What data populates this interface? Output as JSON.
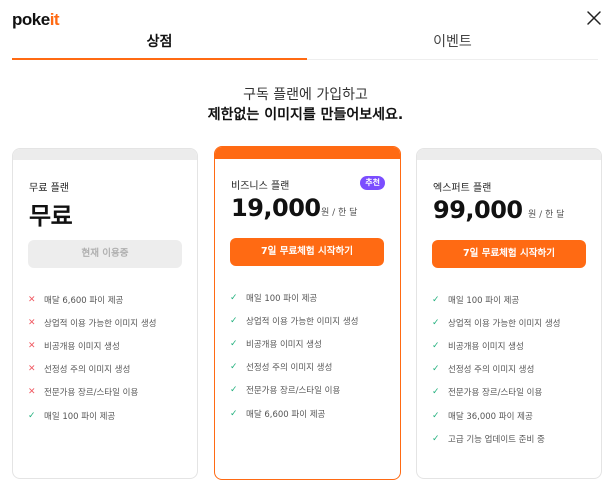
{
  "brand": {
    "name_main": "poke",
    "name_accent": "it",
    "accent_color": "#ff6a13"
  },
  "close_icon": "close-icon",
  "tabs": [
    {
      "label": "상점",
      "active": true
    },
    {
      "label": "이벤트",
      "active": false
    }
  ],
  "headline": {
    "line1": "구독 플랜에 가입하고",
    "line2": "제한없는 이미지를 만들어보세요."
  },
  "plans": [
    {
      "name": "무료 플랜",
      "price": "무료",
      "unit": "",
      "badge": "",
      "button": "현재 이용중",
      "button_state": "disabled",
      "features": [
        {
          "text": "매달 6,600 파이 제공",
          "included": false
        },
        {
          "text": "상업적 이용 가능한 이미지 생성",
          "included": false
        },
        {
          "text": "비공개용 이미지 생성",
          "included": false
        },
        {
          "text": "선정성 주의 이미지 생성",
          "included": false
        },
        {
          "text": "전문가용 장르/스타일 이용",
          "included": false
        },
        {
          "text": "매일 100 파이 제공",
          "included": true
        }
      ]
    },
    {
      "name": "비즈니스 플랜",
      "price": "19,000",
      "unit": "원 / 한 달",
      "badge": "추천",
      "badge_color": "#7b4dff",
      "button": "7일 무료체험 시작하기",
      "button_state": "active",
      "features": [
        {
          "text": "매일 100 파이 제공",
          "included": true
        },
        {
          "text": "상업적 이용 가능한 이미지 생성",
          "included": true
        },
        {
          "text": "비공개용 이미지 생성",
          "included": true
        },
        {
          "text": "선정성 주의 이미지 생성",
          "included": true
        },
        {
          "text": "전문가용 장르/스타일 이용",
          "included": true
        },
        {
          "text": "매달 6,600 파이 제공",
          "included": true
        }
      ]
    },
    {
      "name": "엑스퍼트 플랜",
      "price": "99,000",
      "unit": "원 / 한 달",
      "badge": "",
      "button": "7일 무료체험 시작하기",
      "button_state": "active",
      "features": [
        {
          "text": "매일 100 파이 제공",
          "included": true
        },
        {
          "text": "상업적 이용 가능한 이미지 생성",
          "included": true
        },
        {
          "text": "비공개용 이미지 생성",
          "included": true
        },
        {
          "text": "선정성 주의 이미지 생성",
          "included": true
        },
        {
          "text": "전문가용 장르/스타일 이용",
          "included": true
        },
        {
          "text": "매달 36,000 파이 제공",
          "included": true
        },
        {
          "text": "고급 기능 업데이트 준비 중",
          "included": true
        }
      ]
    }
  ],
  "colors": {
    "check": "#22b07d",
    "cross": "#f05a63",
    "cta": "#ff6a13"
  }
}
